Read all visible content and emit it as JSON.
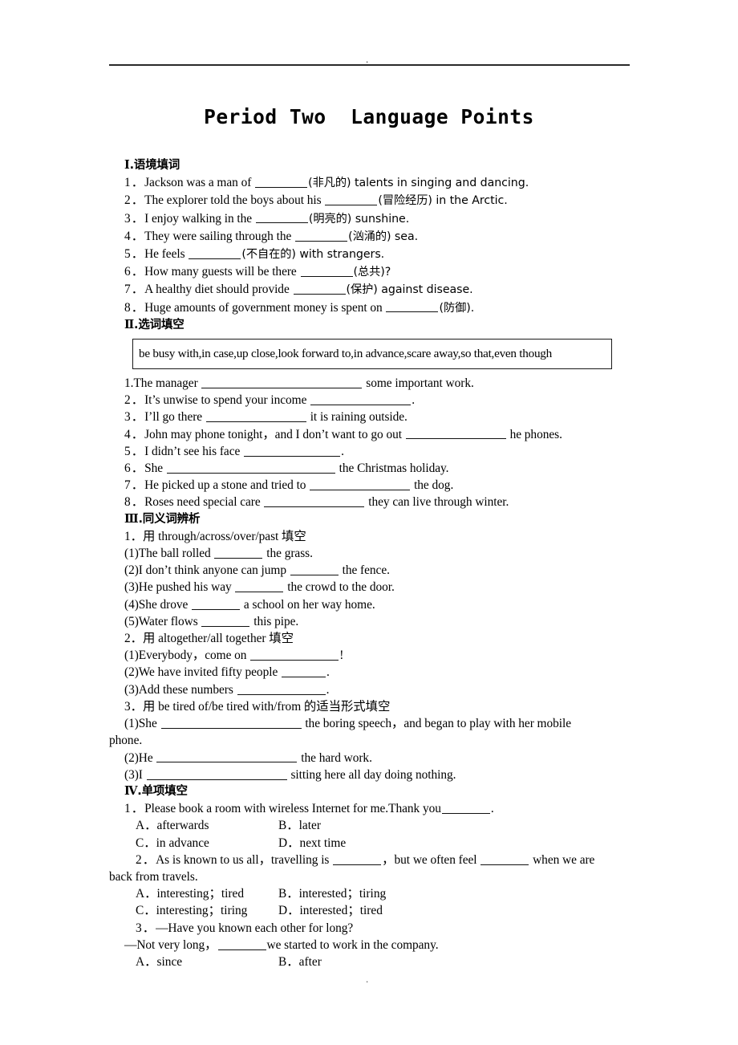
{
  "header": {
    "dot": ".",
    "rule": true
  },
  "title": "Period Two  Language Points",
  "footer": {
    "dot": "."
  },
  "sections": {
    "one": {
      "heading_numeral": "Ⅰ",
      "heading_text": ".语境填词",
      "items": [
        {
          "num": "1．",
          "a": "Jackson was a man of ",
          "b": "(非凡的) talents in singing and dancing."
        },
        {
          "num": "2．",
          "a": "The explorer told the boys about his ",
          "b": "(冒险经历) in the Arctic."
        },
        {
          "num": "3．",
          "a": "I enjoy walking in the ",
          "b": "(明亮的) sunshine."
        },
        {
          "num": "4．",
          "a": "They were sailing through the ",
          "b": "(汹涌的) sea."
        },
        {
          "num": "5．",
          "a": "He feels ",
          "b": "(不自在的) with strangers."
        },
        {
          "num": "6．",
          "a": "How many guests will be there ",
          "b": "(总共)?"
        },
        {
          "num": "7．",
          "a": "A healthy diet should provide ",
          "b": "(保护) against disease."
        },
        {
          "num": "8．",
          "a": "Huge amounts of government money is spent on ",
          "b": "(防御)."
        }
      ]
    },
    "two": {
      "heading_numeral": "Ⅱ",
      "heading_text": ".选词填空",
      "word_bank": "be busy with,in case,up close,look forward to,in advance,scare away,so that,even though",
      "items": [
        {
          "num": "1.",
          "a": "The manager ",
          "b": " some important work."
        },
        {
          "num": "2．",
          "a": "It’s unwise to spend your income ",
          "b": "."
        },
        {
          "num": "3．",
          "a": "I’ll go there ",
          "b": " it is raining outside."
        },
        {
          "num": "4．",
          "a": "John may phone tonight，and I don’t want to go out ",
          "b": " he phones."
        },
        {
          "num": "5．",
          "a": "I didn’t see his face ",
          "b": "."
        },
        {
          "num": "6．",
          "a": "She ",
          "b": " the Christmas holiday."
        },
        {
          "num": "7．",
          "a": "He picked up a stone and tried to ",
          "b": " the dog."
        },
        {
          "num": "8．",
          "a": "Roses need special care ",
          "b": " they can live through winter."
        }
      ]
    },
    "three": {
      "heading_numeral": "Ⅲ",
      "heading_text": ".同义词辨析",
      "group1_prompt": "1．用 through/across/over/past 填空",
      "group1": [
        {
          "num": "(1)",
          "a": "The ball rolled ",
          "b": " the grass."
        },
        {
          "num": "(2)",
          "a": "I don’t think anyone can jump ",
          "b": " the fence."
        },
        {
          "num": "(3)",
          "a": "He pushed his way ",
          "b": " the crowd to the door."
        },
        {
          "num": "(4)",
          "a": "She drove ",
          "b": " a school on her way home."
        },
        {
          "num": "(5)",
          "a": "Water flows ",
          "b": " this pipe."
        }
      ],
      "group2_prompt": "2．用 altogether/all together 填空",
      "group2": [
        {
          "num": "(1)",
          "a": "Everybody，come on ",
          "b": "!"
        },
        {
          "num": "(2)",
          "a": "We have invited fifty people ",
          "b": "."
        },
        {
          "num": "(3)",
          "a": "Add these numbers ",
          "b": "."
        }
      ],
      "group3_prompt": "3．用 be tired of/be tired with/from 的适当形式填空",
      "group3": [
        {
          "num": "(1)",
          "a": "She ",
          "b": " the boring speech，and began to play with her mobile",
          "wrap": "phone."
        },
        {
          "num": "(2)",
          "a": "He ",
          "b": " the hard work."
        },
        {
          "num": "(3)",
          "a": "I ",
          "b": " sitting here all day doing nothing."
        }
      ]
    },
    "four": {
      "heading_numeral": "Ⅳ",
      "heading_text": ".单项填空",
      "q1": {
        "num": "1．",
        "a": "Please book a room with wireless Internet for me.Thank you",
        "b": ".",
        "optA": "A．afterwards",
        "optB": "B．later",
        "optC": "C．in advance",
        "optD": "D．next time"
      },
      "q2": {
        "num": "2．",
        "a": "As is known to us all，travelling is ",
        "b": "，but we often feel ",
        "c": " when we are",
        "wrap": "back from travels.",
        "optA": "A．interesting；tired",
        "optB": "B．interested；tiring",
        "optC": "C．interesting；tiring",
        "optD": "D．interested；tired"
      },
      "q3": {
        "num": "3．",
        "stem": "—Have you known each other for long?",
        "reply_a": "—Not very long，",
        "reply_b": "we started to work in the company.",
        "optA": "A．since",
        "optB": "B．after"
      }
    }
  }
}
